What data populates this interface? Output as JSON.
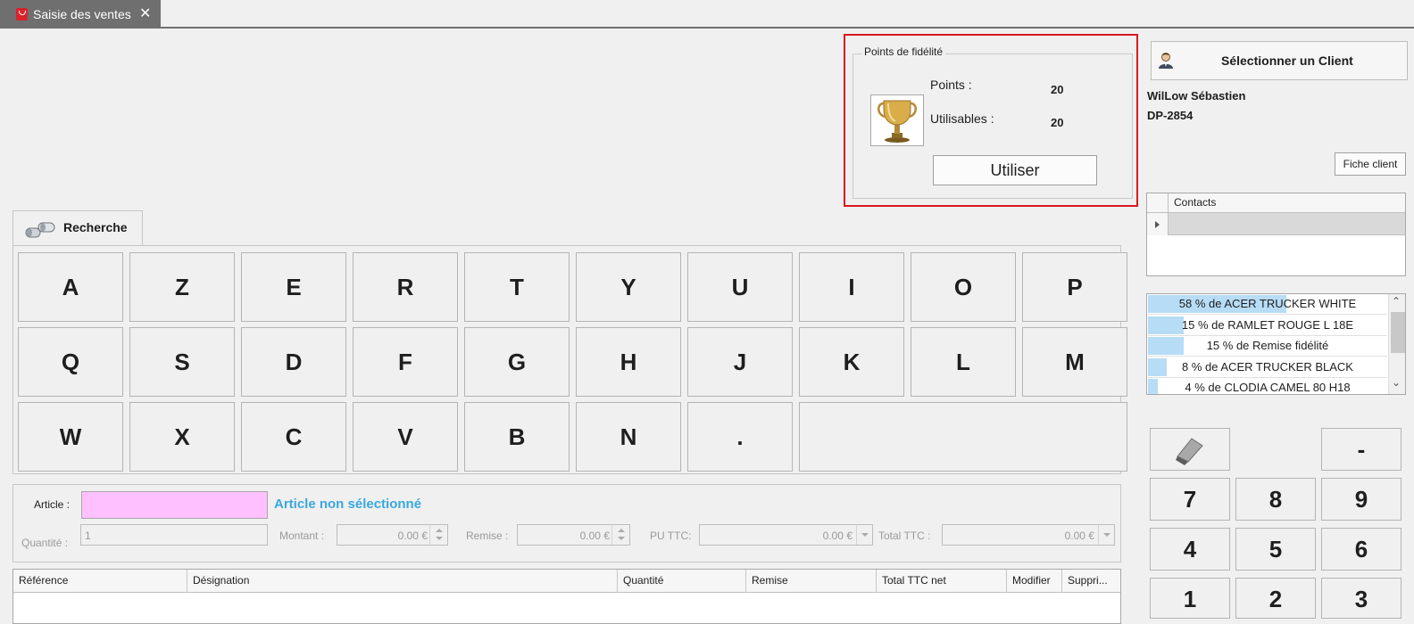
{
  "tab": {
    "title": "Saisie des ventes",
    "close": "✕"
  },
  "fidelity": {
    "legend": "Points de fidélité",
    "points_label": "Points :",
    "points_value": "20",
    "usable_label": "Utilisables :",
    "usable_value": "20",
    "use_button": "Utiliser",
    "highlight_color": "#d71920"
  },
  "client": {
    "select_button": "Sélectionner un Client",
    "name": "WilLow Sébastien",
    "code": "DP-2854",
    "fiche_button": "Fiche client"
  },
  "contacts": {
    "header": "Contacts"
  },
  "promotions": [
    {
      "label": "58 % de ACER TRUCKER WHITE",
      "percent": 58
    },
    {
      "label": "15 % de RAMLET ROUGE L 18E",
      "percent": 15
    },
    {
      "label": "15 % de Remise fidélité",
      "percent": 15
    },
    {
      "label": "8 % de ACER TRUCKER BLACK",
      "percent": 8
    },
    {
      "label": "4 % de CLODIA CAMEL 80 H18",
      "percent": 4
    }
  ],
  "search": {
    "tab_label": "Recherche",
    "keys": [
      [
        "A",
        "Z",
        "E",
        "R",
        "T",
        "Y",
        "U",
        "I",
        "O",
        "P"
      ],
      [
        "Q",
        "S",
        "D",
        "F",
        "G",
        "H",
        "J",
        "K",
        "L",
        "M"
      ],
      [
        "W",
        "X",
        "C",
        "V",
        "B",
        "N",
        "."
      ]
    ]
  },
  "article": {
    "article_label": "Article :",
    "status": "Article non sélectionné",
    "quantity_label": "Quantité :",
    "quantity_value": "1",
    "amount_label": "Montant :",
    "amount_value": "0.00 €",
    "discount_label": "Remise :",
    "discount_value": "0.00 €",
    "pu_label": "PU TTC:",
    "pu_value": "0.00 €",
    "total_label": "Total TTC :",
    "total_value": "0.00 €"
  },
  "grid": {
    "columns": [
      "Référence",
      "Désignation",
      "Quantité",
      "Remise",
      "Total TTC net",
      "Modifier",
      "Suppri..."
    ]
  },
  "keypad": {
    "eraser_icon": "eraser-icon",
    "minus": "-",
    "digits": [
      "7",
      "8",
      "9",
      "4",
      "5",
      "6",
      "1",
      "2",
      "3"
    ]
  }
}
